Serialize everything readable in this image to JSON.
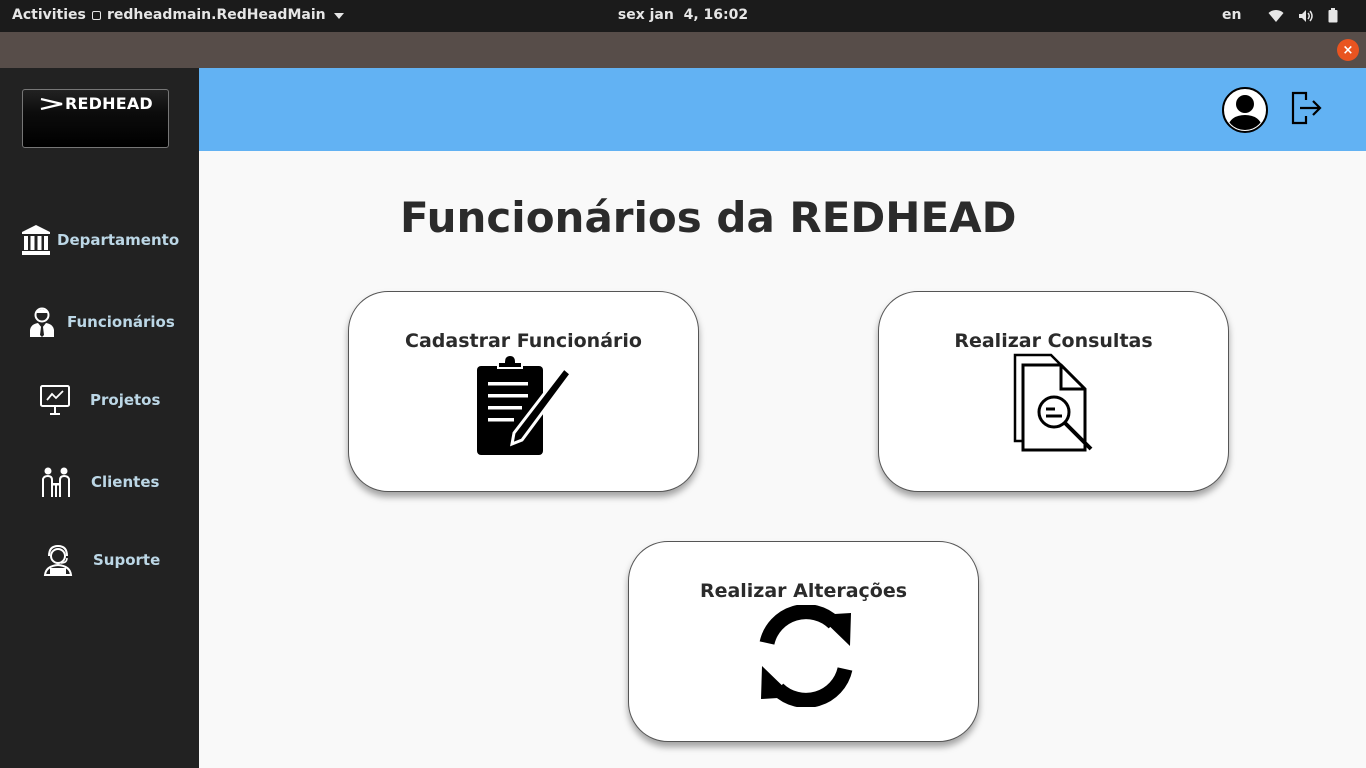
{
  "topbar": {
    "activities": "Activities",
    "app_name": "redheadmain.RedHeadMain",
    "clock": "sex jan  4, 16:02",
    "lang": "en"
  },
  "window": {
    "close_label": "×"
  },
  "sidebar": {
    "logo_text": "REDHEAD",
    "items": [
      {
        "label": "Departamento",
        "icon": "bank-icon"
      },
      {
        "label": "Funcionários",
        "icon": "employee-icon"
      },
      {
        "label": "Projetos",
        "icon": "presentation-icon"
      },
      {
        "label": "Clientes",
        "icon": "meeting-icon"
      },
      {
        "label": "Suporte",
        "icon": "support-agent-icon"
      }
    ]
  },
  "main": {
    "title": "Funcionários da REDHEAD",
    "cards": [
      {
        "label": "Cadastrar Funcionário",
        "icon": "clipboard-pencil-icon"
      },
      {
        "label": "Realizar Consultas",
        "icon": "document-search-icon"
      },
      {
        "label": "Realizar Alterações",
        "icon": "refresh-icon"
      }
    ]
  },
  "colors": {
    "header": "#62b2f3",
    "sidebar": "#222222",
    "sidebar_text": "#bcd7e6",
    "content_bg": "#f9f9f9",
    "close_button": "#e95420"
  }
}
